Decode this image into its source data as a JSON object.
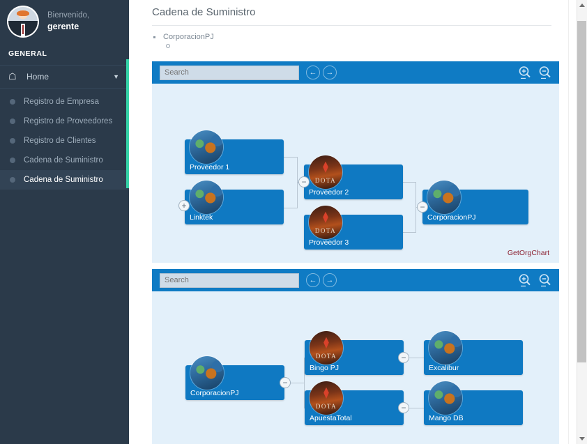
{
  "sidebar": {
    "user": {
      "welcome": "Bienvenido,",
      "name": "gerente",
      "avatar_icon": "user-avatar-icon"
    },
    "section_label": "GENERAL",
    "home": {
      "label": "Home",
      "icon": "home-icon",
      "chevron": "chevron-down-icon"
    },
    "items": [
      {
        "label": "Registro de Empresa",
        "active": false
      },
      {
        "label": "Registro de Proveedores",
        "active": false
      },
      {
        "label": "Registro de Clientes",
        "active": false
      },
      {
        "label": "Cadena de Suministro",
        "active": false
      },
      {
        "label": "Cadena de Suministro",
        "active": true
      }
    ],
    "accent_color": "#35d3a7",
    "background_color": "#2b3a4a"
  },
  "main": {
    "page_title": "Cadena de Suministro",
    "breadcrumb": {
      "root": "CorporacionPJ",
      "child": ""
    }
  },
  "charts": [
    {
      "toolbar": {
        "search_value": "",
        "search_placeholder": "Search",
        "prev_icon": "arrow-left-circle-icon",
        "next_icon": "arrow-right-circle-icon",
        "zoom_in_icon": "zoom-in-icon",
        "zoom_out_icon": "zoom-out-icon",
        "background_color": "#0f7bc4"
      },
      "watermark": "GetOrgChart",
      "nodes": [
        {
          "id": "n1",
          "label": "Proveedor 1",
          "avatar": "hero-avatar-icon"
        },
        {
          "id": "n2",
          "label": "Linktek",
          "avatar": "hero-avatar-icon"
        },
        {
          "id": "n3",
          "label": "Proveedor 2",
          "avatar": "dota-avatar-icon"
        },
        {
          "id": "n4",
          "label": "Proveedor 3",
          "avatar": "dota-avatar-icon"
        },
        {
          "id": "n5",
          "label": "CorporacionPJ",
          "avatar": "hero-avatar-icon"
        }
      ],
      "toggles": [
        {
          "id": "t1",
          "symbol": "+"
        },
        {
          "id": "t2",
          "symbol": "−"
        },
        {
          "id": "t3",
          "symbol": "−"
        }
      ]
    },
    {
      "toolbar": {
        "search_value": "",
        "search_placeholder": "Search",
        "prev_icon": "arrow-left-circle-icon",
        "next_icon": "arrow-right-circle-icon",
        "zoom_in_icon": "zoom-in-icon",
        "zoom_out_icon": "zoom-out-icon",
        "background_color": "#0f7bc4"
      },
      "watermark": "",
      "nodes": [
        {
          "id": "m1",
          "label": "CorporacionPJ",
          "avatar": "hero-avatar-icon"
        },
        {
          "id": "m2",
          "label": "Bingo PJ",
          "avatar": "dota-avatar-icon"
        },
        {
          "id": "m3",
          "label": "ApuestaTotal",
          "avatar": "dota-avatar-icon"
        },
        {
          "id": "m4",
          "label": "Excalibur",
          "avatar": "hero-avatar-icon"
        },
        {
          "id": "m5",
          "label": "Mango DB",
          "avatar": "hero-avatar-icon"
        }
      ],
      "toggles": [
        {
          "id": "s1",
          "symbol": "−"
        },
        {
          "id": "s2",
          "symbol": "−"
        },
        {
          "id": "s3",
          "symbol": "−"
        }
      ]
    }
  ],
  "colors": {
    "node_blue": "#0f79c2",
    "canvas_blue": "#e3f0fa",
    "toolbar_blue": "#0f7bc4",
    "watermark_red": "#8b2030"
  }
}
